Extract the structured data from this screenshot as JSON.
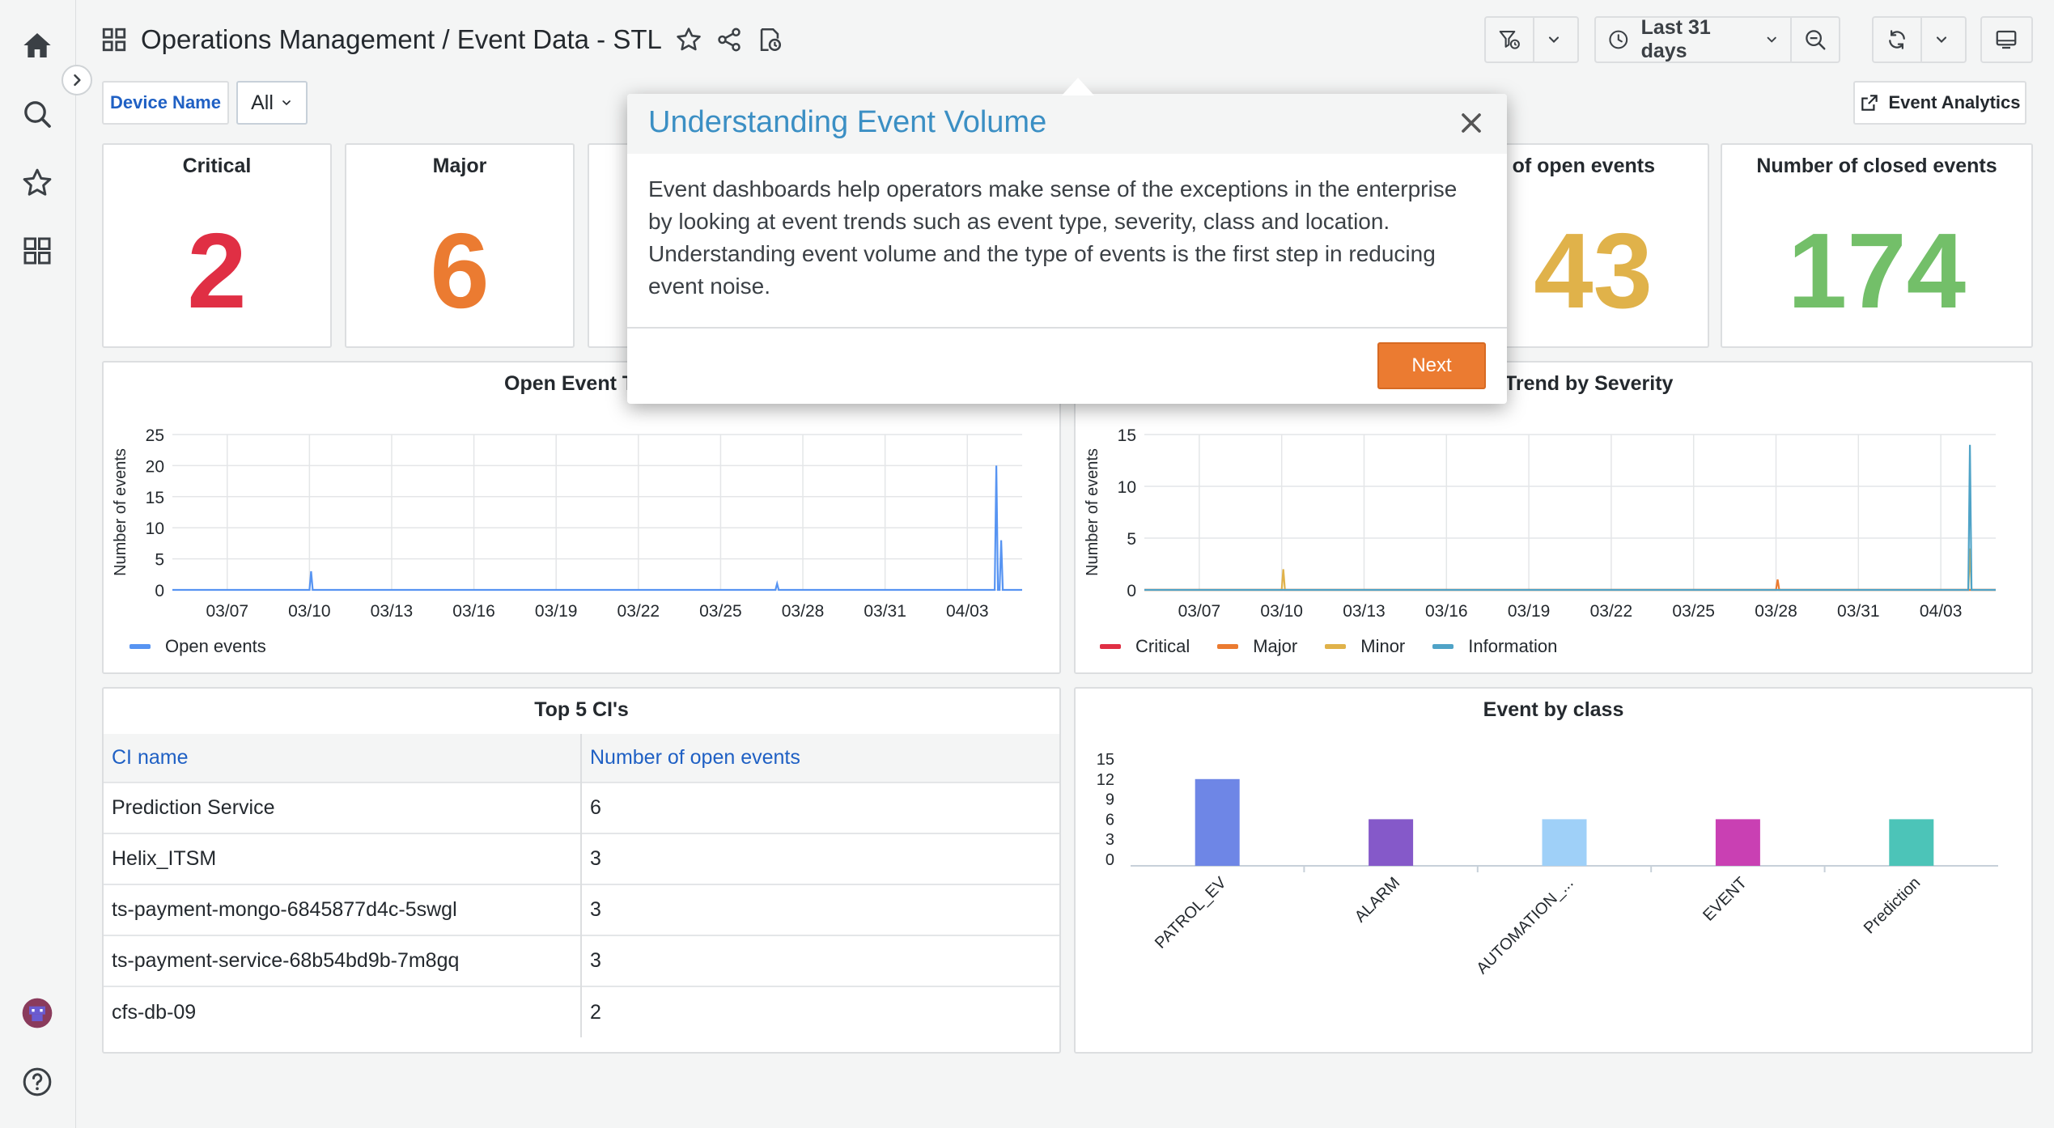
{
  "header": {
    "title": "Operations Management",
    "subtitle": "/ Event Data - STL",
    "time_range": "Last 31 days"
  },
  "filters": {
    "device_label": "Device Name",
    "device_value": "All"
  },
  "actions": {
    "event_analytics": "Event Analytics"
  },
  "stats": [
    {
      "label": "Critical",
      "value": "2",
      "color": "#e02f44"
    },
    {
      "label": "Major",
      "value": "6",
      "color": "#eb7b31"
    },
    {
      "label": "er of open events",
      "value": "43",
      "color": "#e0b24a"
    },
    {
      "label": "Number of closed events",
      "value": "174",
      "color": "#73bf69"
    }
  ],
  "panels": {
    "open_trend_title": "Open Event Tr",
    "severity_trend_title": "Trend by Severity",
    "top_ci_title": "Top 5 CI's",
    "event_class_title": "Event by class"
  },
  "colors": {
    "critical": "#e02f44",
    "major": "#eb7b31",
    "minor": "#e0b24a",
    "information": "#4fa3c7",
    "open": "#5794f2",
    "accent_link": "#1f60c4",
    "modal_title": "#3b8fc4",
    "next_button": "#eb7b31"
  },
  "top_ci": {
    "headers": [
      "CI name",
      "Number of open events"
    ],
    "rows": [
      [
        "Prediction Service",
        "6"
      ],
      [
        "Helix_ITSM",
        "3"
      ],
      [
        "ts-payment-mongo-6845877d4c-5swgl",
        "3"
      ],
      [
        "ts-payment-service-68b54bd9b-7m8gq",
        "3"
      ],
      [
        "cfs-db-09",
        "2"
      ]
    ]
  },
  "modal": {
    "title": "Understanding Event Volume",
    "body": "Event dashboards help operators make sense of the exceptions in the enterprise by looking at event trends such as event type, severity, class and location. Understanding event volume and the type of events is the first step in reducing event noise.",
    "next_label": "Next"
  },
  "chart_data": [
    {
      "type": "line",
      "title": "Open Event Tr",
      "ylabel": "Number of events",
      "ylim": [
        0,
        25
      ],
      "yticks": [
        0,
        5,
        10,
        15,
        20,
        25
      ],
      "xticks": [
        "03/07",
        "03/10",
        "03/13",
        "03/16",
        "03/19",
        "03/22",
        "03/25",
        "03/28",
        "03/31",
        "04/03"
      ],
      "xrange": [
        "03/05",
        "04/05"
      ],
      "legend": "bottom-left",
      "series": [
        {
          "name": "Open events",
          "color": "#5794f2",
          "points": [
            [
              "03/05",
              0
            ],
            [
              "03/10",
              0
            ],
            [
              "03/10",
              3
            ],
            [
              "03/10",
              0
            ],
            [
              "03/27",
              0
            ],
            [
              "03/27",
              1
            ],
            [
              "03/27",
              0
            ],
            [
              "04/04",
              0
            ],
            [
              "04/04",
              20
            ],
            [
              "04/04",
              0
            ],
            [
              "04/04",
              0
            ],
            [
              "04/04",
              8
            ],
            [
              "04/04",
              0
            ],
            [
              "04/05",
              0
            ]
          ]
        }
      ]
    },
    {
      "type": "line",
      "title": "Trend by Severity",
      "ylabel": "Number of events",
      "ylim": [
        0,
        15
      ],
      "yticks": [
        0,
        5,
        10,
        15
      ],
      "xticks": [
        "03/07",
        "03/10",
        "03/13",
        "03/16",
        "03/19",
        "03/22",
        "03/25",
        "03/28",
        "03/31",
        "04/03"
      ],
      "xrange": [
        "03/05",
        "04/05"
      ],
      "legend": "bottom-left",
      "series": [
        {
          "name": "Critical",
          "color": "#e02f44",
          "points": [
            [
              "03/05",
              0
            ],
            [
              "04/05",
              0
            ]
          ]
        },
        {
          "name": "Major",
          "color": "#eb7b31",
          "points": [
            [
              "03/05",
              0
            ],
            [
              "03/28",
              0
            ],
            [
              "03/28",
              1
            ],
            [
              "03/28",
              0
            ],
            [
              "04/05",
              0
            ]
          ]
        },
        {
          "name": "Minor",
          "color": "#e0b24a",
          "points": [
            [
              "03/05",
              0
            ],
            [
              "03/10",
              0
            ],
            [
              "03/10",
              2
            ],
            [
              "03/10",
              0
            ],
            [
              "04/04",
              0
            ],
            [
              "04/04",
              4
            ],
            [
              "04/04",
              0
            ],
            [
              "04/05",
              0
            ]
          ]
        },
        {
          "name": "Information",
          "color": "#4fa3c7",
          "points": [
            [
              "03/05",
              0
            ],
            [
              "04/04",
              0
            ],
            [
              "04/04",
              14
            ],
            [
              "04/04",
              0
            ],
            [
              "04/05",
              0
            ]
          ]
        }
      ]
    },
    {
      "type": "bar",
      "title": "Event by class",
      "ylim": [
        0,
        15
      ],
      "yticks": [
        0,
        3,
        6,
        9,
        12,
        15
      ],
      "categories": [
        "PATROL_EV",
        "ALARM",
        "AUTOMATION_...",
        "EVENT",
        "Prediction"
      ],
      "values": [
        12,
        6,
        6,
        6,
        6
      ],
      "colors": [
        "#6e86e6",
        "#8559c9",
        "#9fd0f8",
        "#c940b3",
        "#4cc4b8"
      ]
    }
  ]
}
